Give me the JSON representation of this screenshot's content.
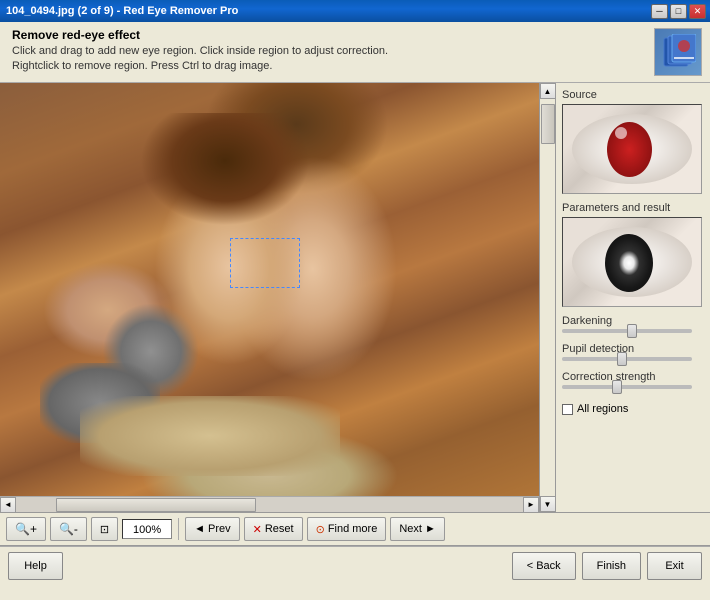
{
  "window": {
    "title": "104_0494.jpg (2 of 9) - Red Eye Remover Pro"
  },
  "title_buttons": {
    "minimize": "─",
    "maximize": "□",
    "close": "✕"
  },
  "header": {
    "title": "Remove red-eye effect",
    "line1": "Click and drag to add new eye region. Click inside region to adjust correction.",
    "line2": "Rightclick to remove region. Press Ctrl to drag image."
  },
  "right_panel": {
    "source_label": "Source",
    "params_label": "Parameters and result",
    "darkening_label": "Darkening",
    "pupil_label": "Pupil detection",
    "correction_label": "Correction strength",
    "all_regions_label": "All regions",
    "darkening_value": 55,
    "pupil_value": 50,
    "correction_value": 45
  },
  "toolbar": {
    "zoom_in_label": "🔍",
    "zoom_out_label": "🔍",
    "fit_label": "⊡",
    "zoom_value": "100%",
    "prev_label": "◄ Prev",
    "reset_label": "✕ Reset",
    "find_more_label": "⊙ Find more",
    "next_label": "Next ►"
  },
  "bottom_bar": {
    "help_label": "Help",
    "back_label": "< Back",
    "finish_label": "Finish",
    "exit_label": "Exit"
  }
}
